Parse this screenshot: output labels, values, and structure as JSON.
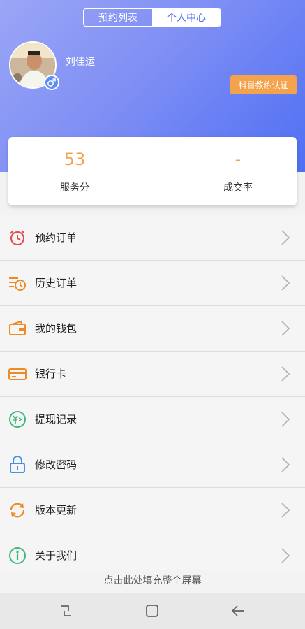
{
  "header": {
    "tabs": [
      {
        "label": "预约列表",
        "active": false
      },
      {
        "label": "个人中心",
        "active": true
      }
    ],
    "username": "刘佳运",
    "gender_icon": "male-icon",
    "cert_button_label": "科目教练认证",
    "gradient_colors": [
      "#9aa6f6",
      "#4f6ff3"
    ]
  },
  "stats": [
    {
      "value": "53",
      "label": "服务分"
    },
    {
      "value": "-",
      "label": "成交率"
    }
  ],
  "menu": [
    {
      "label": "预约订单",
      "icon": "alarm-clock-icon",
      "color": "#e5484d"
    },
    {
      "label": "历史订单",
      "icon": "history-clock-icon",
      "color": "#f08a24"
    },
    {
      "label": "我的钱包",
      "icon": "wallet-icon",
      "color": "#f08a24"
    },
    {
      "label": "银行卡",
      "icon": "bank-card-icon",
      "color": "#f08a24"
    },
    {
      "label": "提现记录",
      "icon": "withdraw-yuan-icon",
      "color": "#3cb878"
    },
    {
      "label": "修改密码",
      "icon": "lock-icon",
      "color": "#4a90e2"
    },
    {
      "label": "版本更新",
      "icon": "refresh-icon",
      "color": "#f08a24"
    },
    {
      "label": "关于我们",
      "icon": "info-icon",
      "color": "#3cb878"
    }
  ],
  "fill_screen_text": "点击此处填充整个屏幕",
  "navbar": {
    "buttons": [
      "recent-apps-icon",
      "home-icon",
      "back-icon"
    ]
  },
  "accent_color": "#f4a24b"
}
